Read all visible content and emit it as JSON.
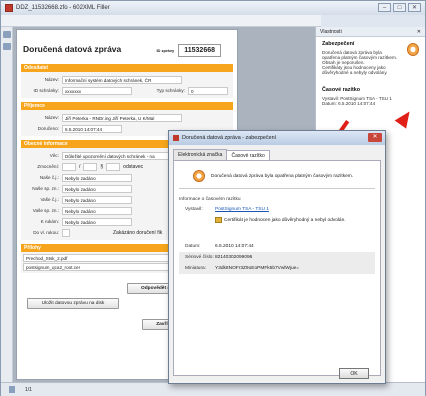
{
  "window": {
    "title": "DDZ_11532668.zfo - 602XML Filler",
    "buttons": [
      "–",
      "□",
      "✕"
    ]
  },
  "document": {
    "heading": "Doručená datová zpráva",
    "id_label": "ID zprávy",
    "id_value": "11532668",
    "sections": {
      "sender": "Odesílatel",
      "recipient": "Příjemce",
      "general": "Obecné informace",
      "attachments": "Přílohy"
    },
    "sender": {
      "name_label": "Název:",
      "name_value": "Informační systém datových schránek, ČR",
      "box_label": "ID schránky:",
      "box_value": "xxxxxxx",
      "type_label": "Typ schránky:",
      "type_value": "0"
    },
    "recipient": {
      "name_label": "Název:",
      "name_value": "Jiří Peterka - RNDr.ing Jiří Peterka, U K/Mal",
      "delivered_label": "Doručeno:",
      "delivered_value": "6.5.2010 14:07:44"
    },
    "general": {
      "subject_label": "Věc:",
      "subject_value": "Důležité upozornění datových schránek - na",
      "auth_label": "Zmocnění:",
      "auth_value1": "/",
      "auth_value2": "§",
      "auth_value3": "odstavec",
      "ref1_label": "Naše č.j.:",
      "ref1_value": "Nebylo zadáno",
      "ref2_label": "Naše sp. zn.:",
      "ref2_value": "Nebylo zadáno",
      "ref3_label": "Vaše č.j.:",
      "ref3_value": "Nebylo zadáno",
      "ref4_label": "Vaše sp. zn.:",
      "ref4_value": "Nebylo zadáno",
      "attn_label": "K rukám:",
      "attn_value": "Nebylo zadáno",
      "personal_label": "Do vl. rukou:",
      "restricted_label": "Zakázáno doručení fik"
    },
    "attachments": [
      "Prechod_Stsk_2.pdf",
      "postsignum_qca2_root.cer"
    ],
    "buttons": {
      "reply": "Odpovědět na",
      "save": "Uložit datovou zprávu na disk",
      "close": "Zavřít dat"
    }
  },
  "properties": {
    "header": "Vlastnosti",
    "close": "✕",
    "signature": {
      "title": "Zabezpečení",
      "lines": [
        "Doručená datová zpráva byla",
        "opatřena platným časovým razítkem.",
        "Obsah je neporušen.",
        "Certifikáty jsou hodnoceny jako",
        "důvěryhodné a nebyly odvolány."
      ]
    },
    "timestamp": {
      "title": "Časové razítko",
      "lines": [
        "Vystavil: PostSignum TSA - TSU 1",
        "Datum:  6.5.2010 14:07:44"
      ]
    }
  },
  "dialog": {
    "title": "Doručená datová zpráva - zabezpečení",
    "close": "✕",
    "tabs": [
      "Elektronická značka",
      "Časové razítko"
    ],
    "message": "Doručená datová zpráva byla opatřena platným časovým razítkem.",
    "info_heading": "Informace o časovém razítku",
    "issuer_label": "Vystavil:",
    "issuer_value": "PostSignum TSA - TSU 1",
    "cert_note": "Certifikát je hodnocen jako důvěryhodný a nebyl odvolán.",
    "date_label": "Datum:",
    "date_value": "6.5.2010 14:07:44",
    "serial_label": "Sériové číslo:",
    "serial_value": "82140302099096",
    "hash_label": "Miniatura:",
    "hash_value": "Y3dk8NOFr3Z9oEoPMFk5b7VwlWjue=",
    "ok": "OK"
  },
  "status": {
    "page": "1/1"
  },
  "colors": {
    "section_bar": "#f7a51c",
    "arrow": "#e02018"
  }
}
